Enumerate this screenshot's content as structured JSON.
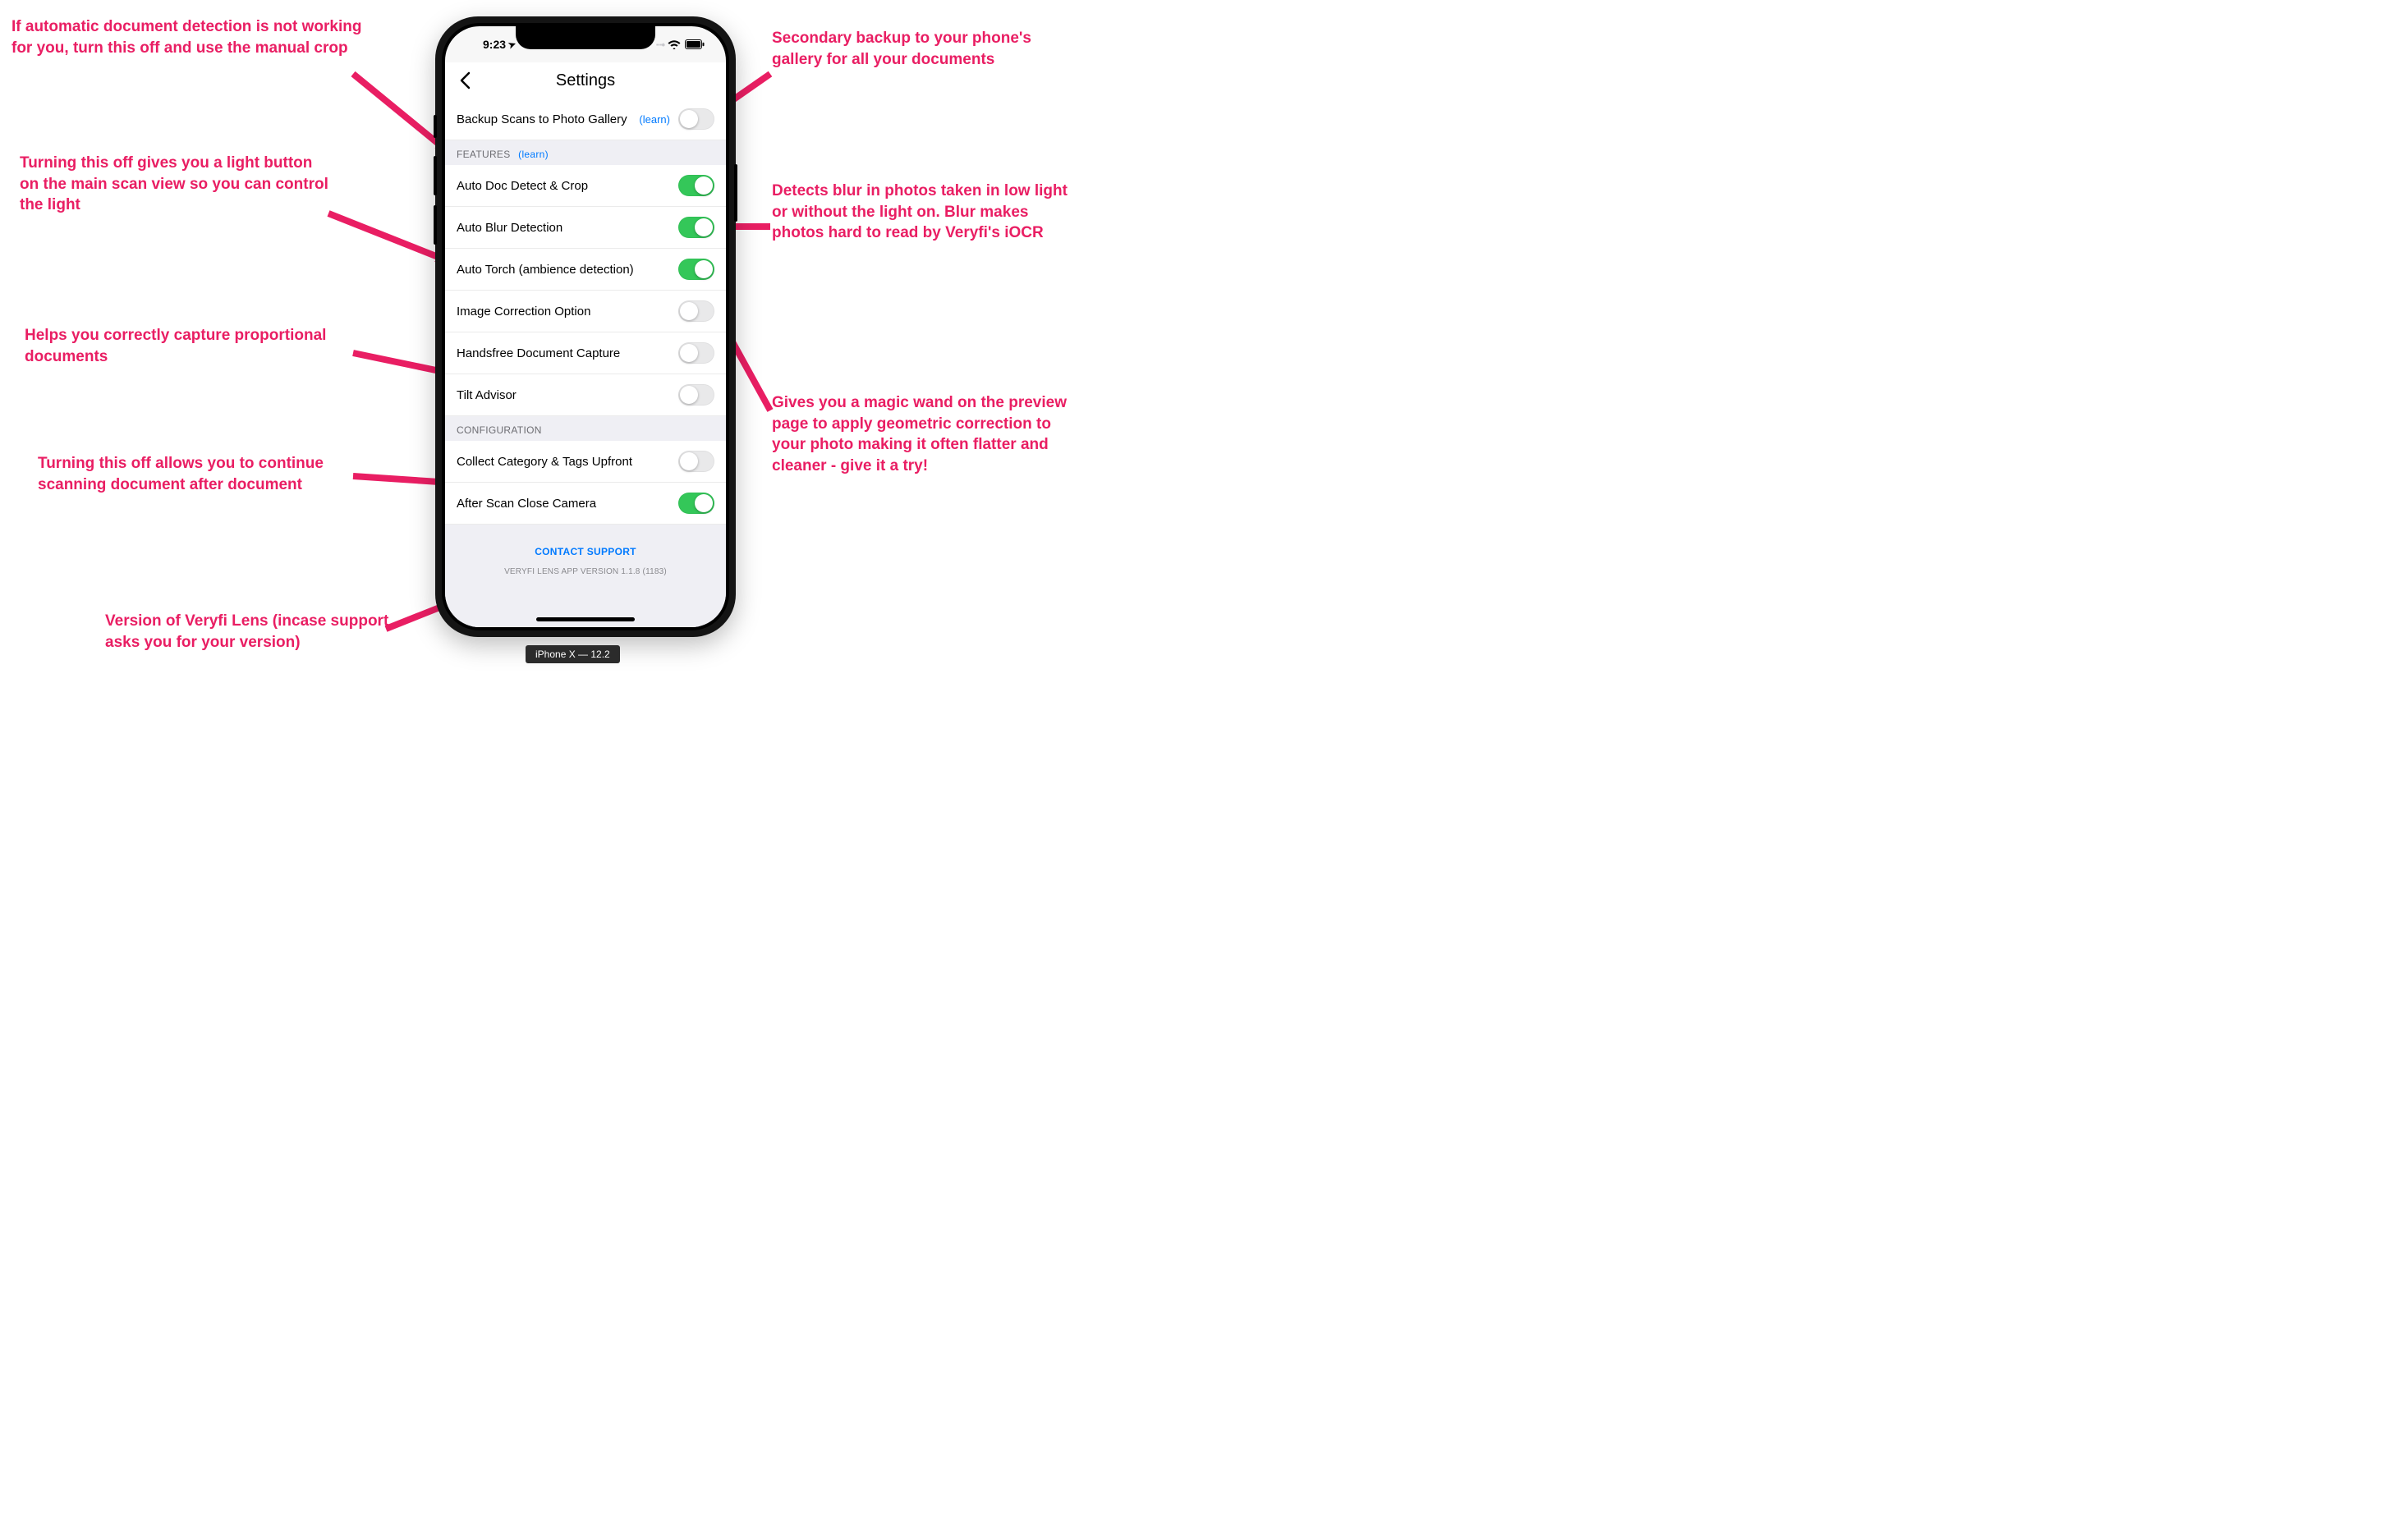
{
  "status": {
    "time": "9:23",
    "location_glyph": "➤"
  },
  "nav": {
    "title": "Settings"
  },
  "rows": {
    "backup": {
      "label": "Backup Scans to Photo Gallery",
      "learn": "(learn)",
      "on": false
    },
    "section_features": {
      "title": "FEATURES",
      "learn": "(learn)"
    },
    "autodoc": {
      "label": "Auto Doc Detect & Crop",
      "on": true
    },
    "autoblur": {
      "label": "Auto Blur Detection",
      "on": true
    },
    "autotorch": {
      "label": "Auto Torch (ambience detection)",
      "on": true
    },
    "imgcorr": {
      "label": "Image Correction Option",
      "on": false
    },
    "handsfree": {
      "label": "Handsfree Document Capture",
      "on": false
    },
    "tilt": {
      "label": "Tilt Advisor",
      "on": false
    },
    "section_config": {
      "title": "CONFIGURATION"
    },
    "collect": {
      "label": "Collect Category & Tags Upfront",
      "on": false
    },
    "afterscan": {
      "label": "After Scan Close Camera",
      "on": true
    }
  },
  "footer": {
    "support": "CONTACT SUPPORT",
    "version": "VERYFI LENS APP VERSION 1.1.8 (1183)"
  },
  "device_label": "iPhone X — 12.2",
  "annotations": {
    "a1": "If automatic document detection is not working for you, turn this off and use the manual crop",
    "a2": "Turning this off gives you a light button on the main scan view so you can control the light",
    "a3": "Helps you correctly capture proportional documents",
    "a4": "Turning this off allows you to continue scanning document after document",
    "a5": "Version of Veryfi Lens (incase support asks you for your version)",
    "b1": "Secondary backup to your phone's gallery for all your documents",
    "b2": "Detects blur in photos taken in low light or without the light on. Blur makes photos hard to read by Veryfi's iOCR",
    "b3": "Gives you a magic wand on the preview page to apply geometric correction to your photo making it often flatter and cleaner - give it a try!"
  }
}
